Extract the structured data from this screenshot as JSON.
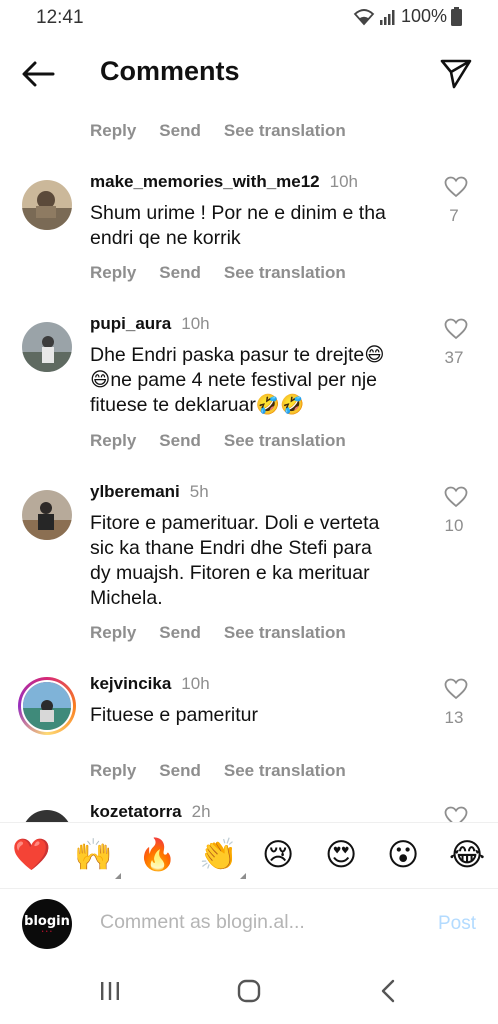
{
  "status": {
    "time": "12:41",
    "battery": "100%",
    "icons": [
      "wifi-icon",
      "signal-icon",
      "battery-icon"
    ]
  },
  "header": {
    "title": "Comments",
    "back_icon": "arrow-left-icon",
    "share_icon": "paper-plane-icon"
  },
  "actions": {
    "reply": "Reply",
    "send": "Send",
    "translate": "See translation"
  },
  "comments": [
    {
      "username": "make_memories_with_me12",
      "time": "10h",
      "lines": [
        "Shum urime ! Por ne e dinim e tha",
        "endri qe ne korrik"
      ],
      "likes": "7"
    },
    {
      "username": "pupi_aura",
      "time": "10h",
      "lines": [
        "Dhe Endri paska pasur te drejte😄",
        "😄ne pame 4 nete festival per nje",
        "fituese te deklaruar🤣🤣"
      ],
      "likes": "37"
    },
    {
      "username": "ylberemani",
      "time": "5h",
      "lines": [
        "Fitore e pamerituar. Doli e verteta",
        "sic ka thane Endri dhe Stefi para",
        "dy muajsh. Fitoren e ka merituar",
        "Michela."
      ],
      "likes": "10"
    },
    {
      "username": "kejvincika",
      "time": "10h",
      "lines": [
        "Fituese e pameritur"
      ],
      "likes": "13"
    },
    {
      "username": "kozetatorra",
      "time": "2h"
    }
  ],
  "emojis": [
    "❤️",
    "🙌",
    "🔥",
    "👏",
    "😢",
    "😍",
    "😮",
    "😂"
  ],
  "composer": {
    "avatar_text": "blogin",
    "placeholder": "Comment as blogin.al...",
    "post": "Post"
  },
  "colors": {
    "secondary_text": "#8e8e8e",
    "post_disabled": "#b3dbff"
  }
}
